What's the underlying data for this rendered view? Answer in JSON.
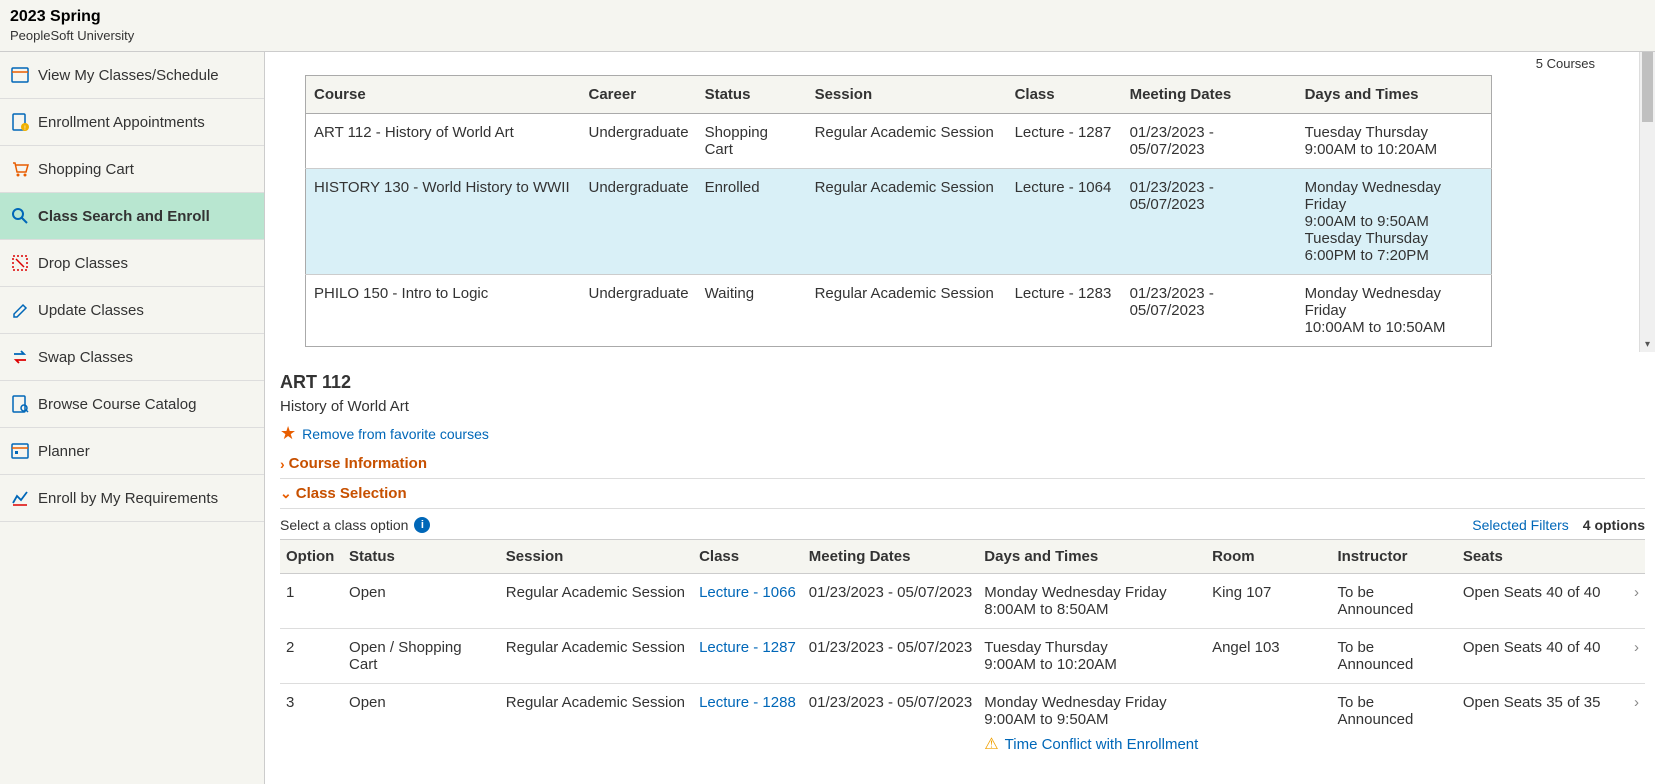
{
  "header": {
    "title": "2023 Spring",
    "subtitle": "PeopleSoft University"
  },
  "sidebar": {
    "items": [
      {
        "label": "View My Classes/Schedule"
      },
      {
        "label": "Enrollment Appointments"
      },
      {
        "label": "Shopping Cart"
      },
      {
        "label": "Class Search and Enroll"
      },
      {
        "label": "Drop Classes"
      },
      {
        "label": "Update Classes"
      },
      {
        "label": "Swap Classes"
      },
      {
        "label": "Browse Course Catalog"
      },
      {
        "label": "Planner"
      },
      {
        "label": "Enroll by My Requirements"
      }
    ]
  },
  "schedule": {
    "count_label": "5 Courses",
    "headers": {
      "course": "Course",
      "career": "Career",
      "status": "Status",
      "session": "Session",
      "class": "Class",
      "dates": "Meeting Dates",
      "times": "Days and Times"
    },
    "rows": [
      {
        "course": "ART 112 - History of World Art",
        "career": "Undergraduate",
        "status": "Shopping Cart",
        "session": "Regular Academic Session",
        "class": "Lecture - 1287",
        "dates": "01/23/2023 - 05/07/2023",
        "times_a": "Tuesday Thursday",
        "times_b": "9:00AM to 10:20AM"
      },
      {
        "course": "HISTORY 130 - World History to WWII",
        "career": "Undergraduate",
        "status": "Enrolled",
        "session": "Regular Academic Session",
        "class": "Lecture - 1064",
        "dates": "01/23/2023 - 05/07/2023",
        "times_a": "Monday Wednesday Friday",
        "times_b": "9:00AM to 9:50AM",
        "times_c": "Tuesday Thursday",
        "times_d": "6:00PM to 7:20PM"
      },
      {
        "course": "PHILO 150 - Intro to Logic",
        "career": "Undergraduate",
        "status": "Waiting",
        "session": "Regular Academic Session",
        "class": "Lecture - 1283",
        "dates": "01/23/2023 - 05/07/2023",
        "times_a": "Monday Wednesday Friday",
        "times_b": "10:00AM to 10:50AM"
      }
    ]
  },
  "detail": {
    "code": "ART 112",
    "title": "History of World Art",
    "remove_link": "Remove from favorite courses",
    "section_info": "Course Information",
    "section_sel": "Class Selection",
    "select_label": "Select a class option",
    "filters_link": "Selected Filters",
    "options_count": "4 options",
    "opt_headers": {
      "option": "Option",
      "status": "Status",
      "session": "Session",
      "class": "Class",
      "dates": "Meeting Dates",
      "times": "Days and Times",
      "room": "Room",
      "instructor": "Instructor",
      "seats": "Seats"
    },
    "options": [
      {
        "n": "1",
        "status": "Open",
        "session": "Regular Academic Session",
        "class": "Lecture - 1066",
        "dates": "01/23/2023 - 05/07/2023",
        "times_a": "Monday Wednesday Friday",
        "times_b": "8:00AM to 8:50AM",
        "room": "King 107",
        "instructor": "To be Announced",
        "seats": "Open Seats 40 of 40"
      },
      {
        "n": "2",
        "status": "Open / Shopping Cart",
        "session": "Regular Academic Session",
        "class": "Lecture - 1287",
        "dates": "01/23/2023 - 05/07/2023",
        "times_a": "Tuesday Thursday",
        "times_b": "9:00AM to 10:20AM",
        "room": "Angel 103",
        "instructor": "To be Announced",
        "seats": "Open Seats 40 of 40"
      },
      {
        "n": "3",
        "status": "Open",
        "session": "Regular Academic Session",
        "class": "Lecture - 1288",
        "dates": "01/23/2023 - 05/07/2023",
        "times_a": "Monday Wednesday Friday",
        "times_b": "9:00AM to 9:50AM",
        "room": "",
        "instructor": "To be Announced",
        "seats": "Open Seats 35 of 35",
        "warn": "Time Conflict with Enrollment"
      }
    ]
  }
}
